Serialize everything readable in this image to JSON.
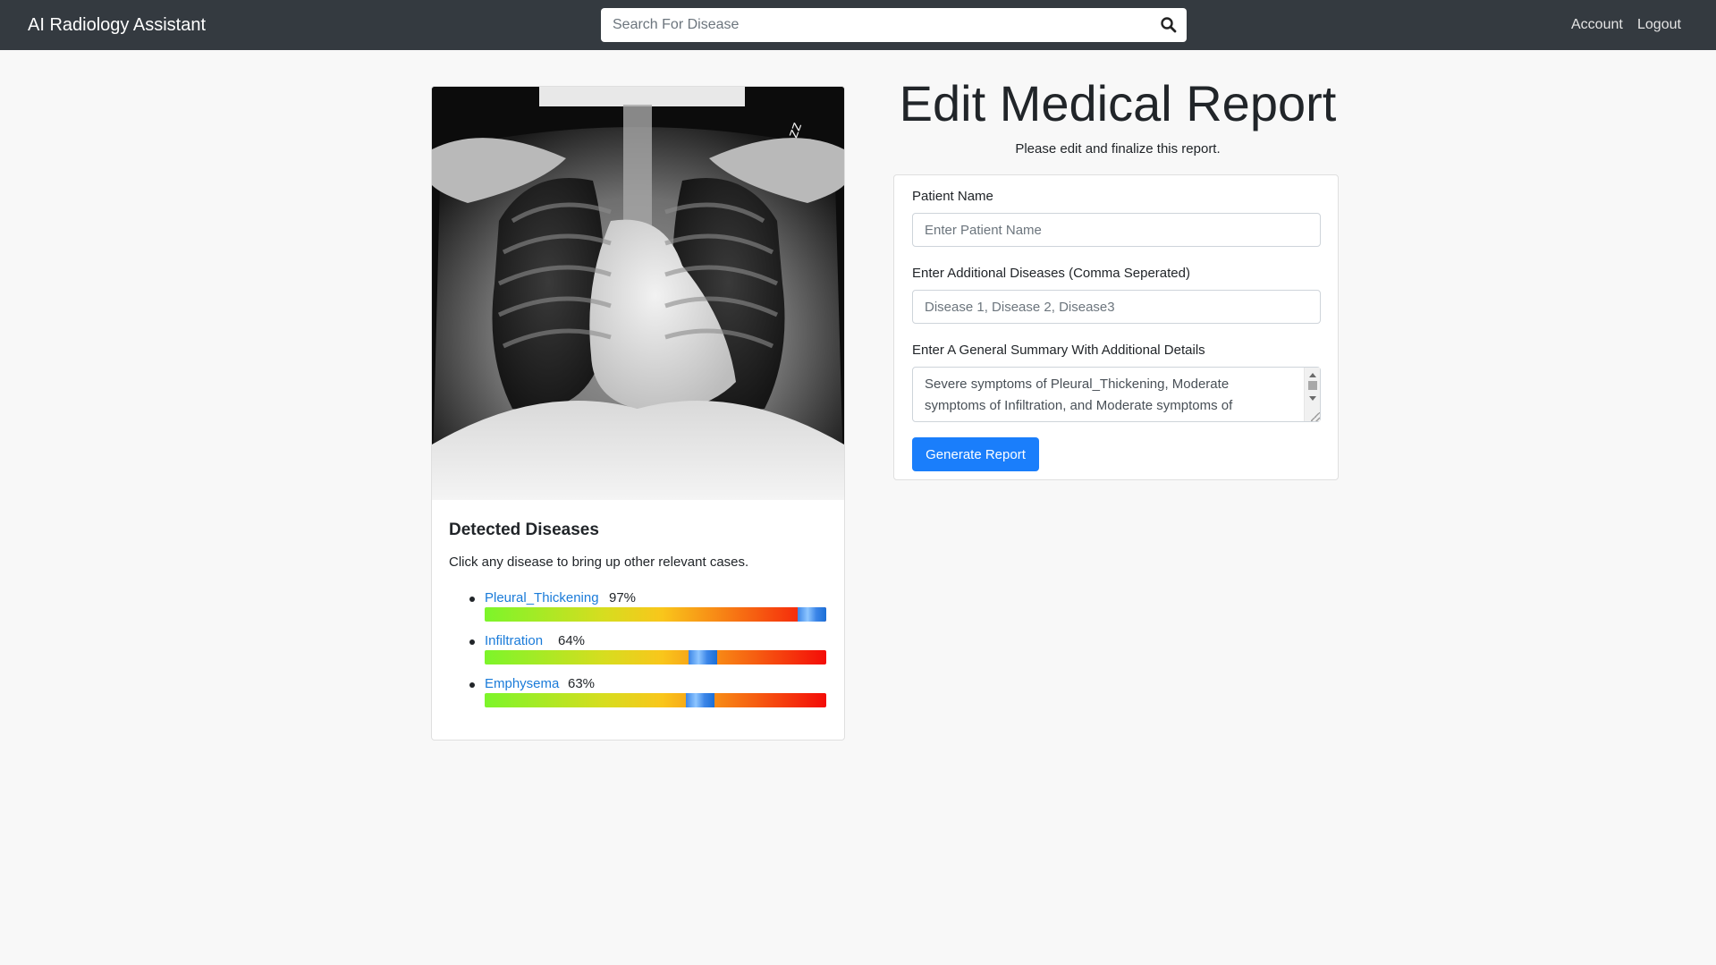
{
  "navbar": {
    "brand": "AI Radiology Assistant",
    "search_placeholder": "Search For Disease",
    "search_icon": "search-icon",
    "links": [
      "Account",
      "Logout"
    ]
  },
  "xray_image": {
    "description_icon": "chest-xray-image"
  },
  "detected": {
    "title": "Detected Diseases",
    "subtitle": "Click any disease to bring up other relevant cases.",
    "items": [
      {
        "name": "Pleural_Thickening",
        "percent_label": "97%",
        "value": 97
      },
      {
        "name": "Infiltration",
        "percent_label": "64%",
        "value": 64
      },
      {
        "name": "Emphysema",
        "percent_label": "63%",
        "value": 63
      }
    ]
  },
  "report": {
    "title": "Edit Medical Report",
    "subtitle": "Please edit and finalize this report.",
    "patient_label": "Patient Name",
    "patient_placeholder": "Enter Patient Name",
    "diseases_label": "Enter Additional Diseases (Comma Seperated)",
    "diseases_placeholder": "Disease 1, Disease 2, Disease3",
    "summary_label": "Enter A General Summary With Additional Details",
    "summary_value": "Severe symptoms of Pleural_Thickening, Moderate symptoms of Infiltration, and Moderate symptoms of Emphysema",
    "generate_label": "Generate Report"
  },
  "colors": {
    "navbar": "#343a40",
    "link": "#1a7bd9",
    "primary_button": "#1a7efb",
    "background": "#f8f8f8"
  }
}
